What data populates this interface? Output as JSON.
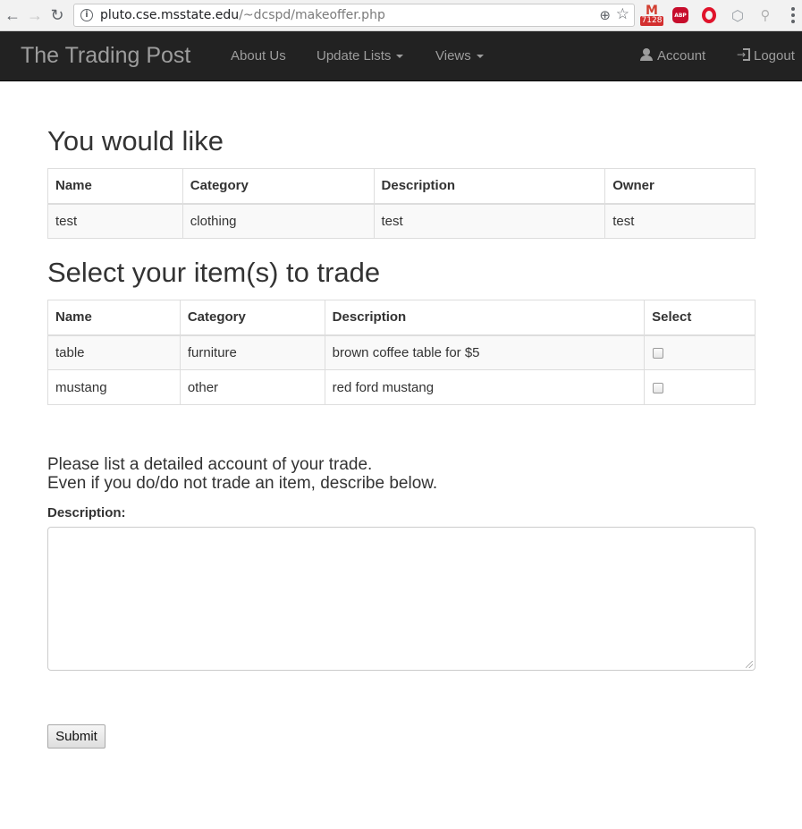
{
  "browser": {
    "url_host": "pluto.cse.msstate.edu",
    "url_path": "/~dcspd/makeoffer.php",
    "gmail_badge": "7128",
    "abp_label": "ABP",
    "icons": [
      "back-icon",
      "forward-icon",
      "reload-icon",
      "info-icon",
      "zoom-icon",
      "star-icon",
      "gmail-icon",
      "adblock-icon",
      "opera-icon",
      "cube-icon",
      "search-extension-icon",
      "menu-icon"
    ]
  },
  "navbar": {
    "brand": "The Trading Post",
    "about": "About Us",
    "update_lists": "Update Lists",
    "views": "Views",
    "account": "Account",
    "logout": "Logout"
  },
  "wanted": {
    "heading": "You would like",
    "headers": [
      "Name",
      "Category",
      "Description",
      "Owner"
    ],
    "rows": [
      [
        "test",
        "clothing",
        "test",
        "test"
      ]
    ]
  },
  "offer": {
    "heading": "Select your item(s) to trade",
    "headers": [
      "Name",
      "Category",
      "Description",
      "Select"
    ],
    "rows": [
      [
        "table",
        "furniture",
        "brown coffee table for $5"
      ],
      [
        "mustang",
        "other",
        "red ford mustang"
      ]
    ],
    "selected": [
      false,
      false
    ]
  },
  "form": {
    "intro_line1": "Please list a detailed account of your trade.",
    "intro_line2": "Even if you do/do not trade an item, describe below.",
    "description_label": "Description:",
    "description_value": "",
    "submit_label": "Submit"
  }
}
